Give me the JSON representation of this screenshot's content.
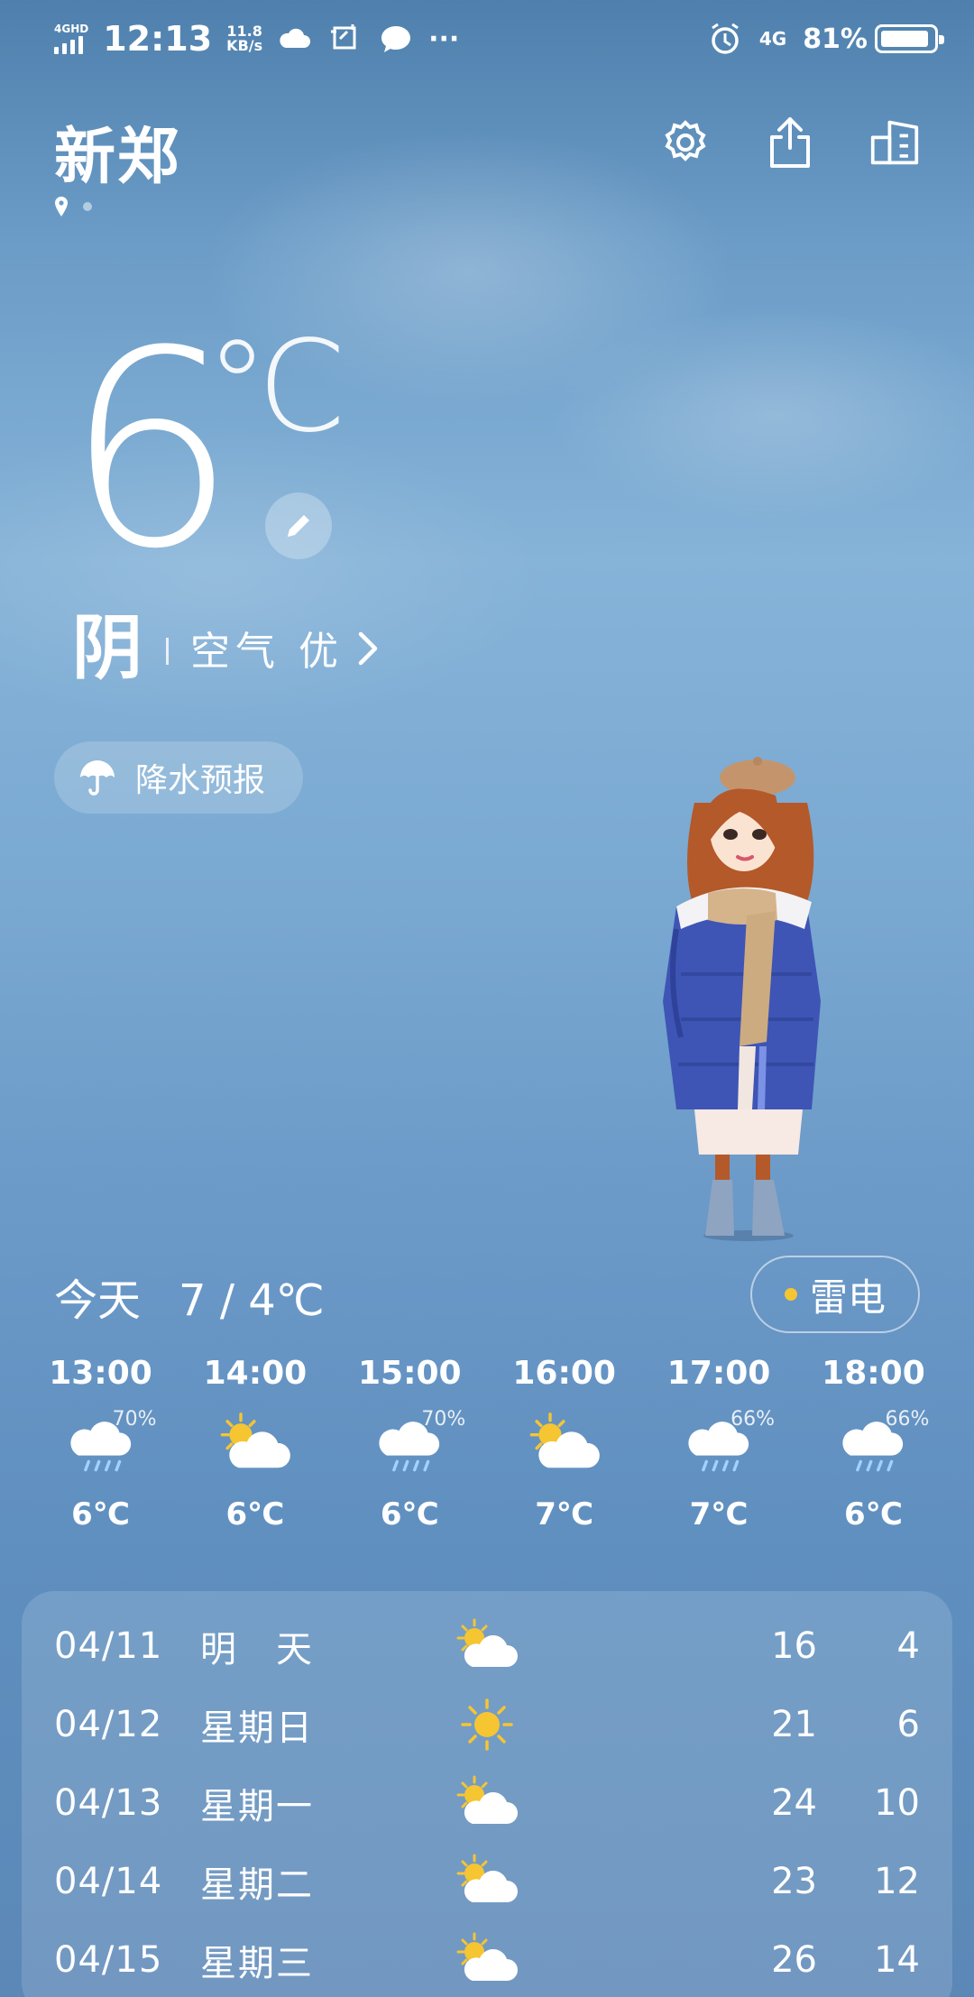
{
  "status_bar": {
    "network": "4GHD",
    "time": "12:13",
    "speed_value": "11.8",
    "speed_unit": "KB/s",
    "more": "···",
    "net_type": "4G",
    "battery": "81%"
  },
  "header": {
    "city": "新郑"
  },
  "current": {
    "temp": "6",
    "unit": "℃",
    "condition": "阴",
    "air_quality": "空气 优"
  },
  "precip_button": "降水预报",
  "today": {
    "label": "今天",
    "range": "7 / 4℃",
    "alert": "雷电"
  },
  "hourly": [
    {
      "time": "13:00",
      "icon": "cloud-rain-icon",
      "pct": "70%",
      "temp": "6℃"
    },
    {
      "time": "14:00",
      "icon": "sun-cloud-icon",
      "pct": "",
      "temp": "6℃"
    },
    {
      "time": "15:00",
      "icon": "cloud-rain-icon",
      "pct": "70%",
      "temp": "6℃"
    },
    {
      "time": "16:00",
      "icon": "sun-cloud-icon",
      "pct": "",
      "temp": "7℃"
    },
    {
      "time": "17:00",
      "icon": "cloud-rain-icon",
      "pct": "66%",
      "temp": "7℃"
    },
    {
      "time": "18:00",
      "icon": "cloud-rain-icon",
      "pct": "66%",
      "temp": "6℃"
    }
  ],
  "daily": [
    {
      "date": "04/11",
      "weekday": "明　天",
      "icon": "sun-cloud-icon",
      "high": "16",
      "low": "4"
    },
    {
      "date": "04/12",
      "weekday": "星期日",
      "icon": "sun-icon",
      "high": "21",
      "low": "6"
    },
    {
      "date": "04/13",
      "weekday": "星期一",
      "icon": "sun-cloud-icon",
      "high": "24",
      "low": "10"
    },
    {
      "date": "04/14",
      "weekday": "星期二",
      "icon": "sun-cloud-icon",
      "high": "23",
      "low": "12"
    },
    {
      "date": "04/15",
      "weekday": "星期三",
      "icon": "sun-cloud-icon",
      "high": "26",
      "low": "14"
    }
  ],
  "colors": {
    "sky_top": "#4f80ad",
    "sky_mid": "#86b3d8",
    "sun": "#f5c532",
    "rain": "#9fd2ff"
  }
}
